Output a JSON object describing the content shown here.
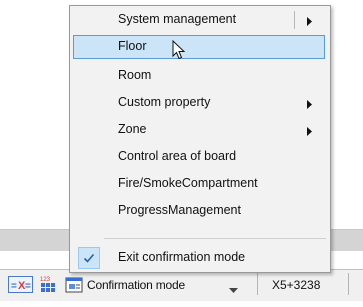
{
  "menu": {
    "items": [
      {
        "label": "System management",
        "submenu": true
      },
      {
        "label": "Floor",
        "submenu": false,
        "highlighted": true
      },
      {
        "label": "Room",
        "submenu": false
      },
      {
        "label": "Custom property",
        "submenu": true
      },
      {
        "label": "Zone",
        "submenu": true
      },
      {
        "label": "Control area of board",
        "submenu": false
      },
      {
        "label": "Fire/SmokeCompartment",
        "submenu": false
      },
      {
        "label": "ProgressManagement",
        "submenu": false
      },
      {
        "label": "Exit confirmation mode",
        "submenu": false,
        "checked": true
      }
    ]
  },
  "status_bar": {
    "mode_label": "Confirmation mode",
    "coordinate": "X5+3238",
    "grid_icon_text": "123"
  },
  "colors": {
    "highlight_bg": "#cce4f7",
    "highlight_border": "#5b9bd5",
    "check_color": "#1e64b4",
    "accent_red": "#d23c3c"
  }
}
